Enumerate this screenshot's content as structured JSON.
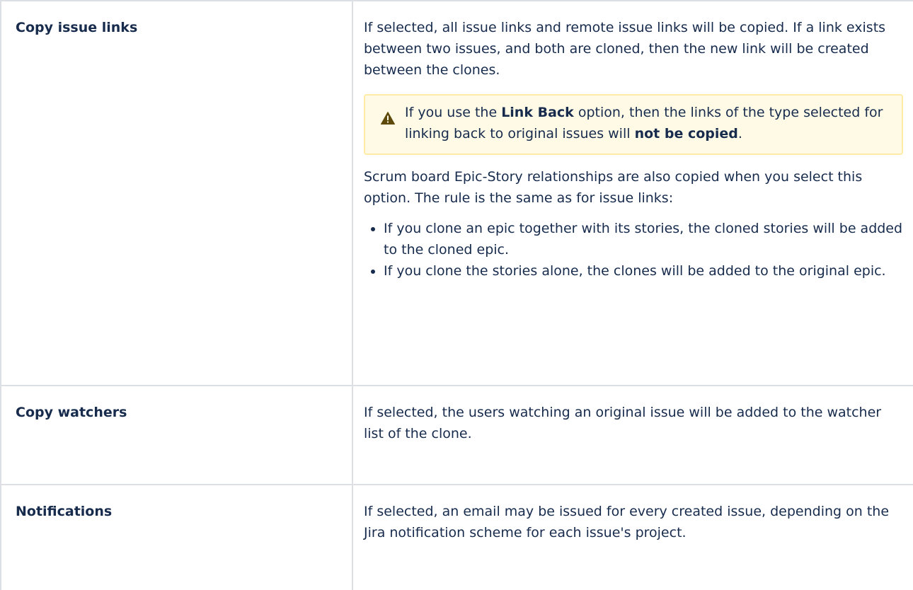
{
  "rows": [
    {
      "option": "Copy issue links",
      "intro": "If selected, all issue links and remote issue links will be copied. If a link exists between two issues, and both are cloned, then the new link will be created between the clones.",
      "warning": {
        "icon": "warning-icon",
        "t1": "If you use the ",
        "b1": "Link Back",
        "t2": " option, then the links of the type selected for linking back to original issues will ",
        "b2": "not be copied",
        "t3": "."
      },
      "after": "Scrum board Epic-Story relationships are also copied when you select this option. The rule is the same as for issue links:",
      "bullets": [
        "If you clone an epic together with its stories, the cloned stories will be added to the cloned epic.",
        "If you clone the stories alone, the clones will be added to the original epic."
      ]
    },
    {
      "option": "Copy watchers",
      "desc": "If selected, the users watching an original issue will be added to the watcher list of the clone."
    },
    {
      "option": "Notifications",
      "desc": "If selected, an email may be issued for every created issue, depending on the Jira notification scheme for each issue's project."
    }
  ],
  "colors": {
    "text": "#172b4d",
    "border": "#dcdfe4",
    "warning_bg": "#fffae6",
    "warning_border": "#ffeba6",
    "warning_icon": "#5e4a0b"
  }
}
